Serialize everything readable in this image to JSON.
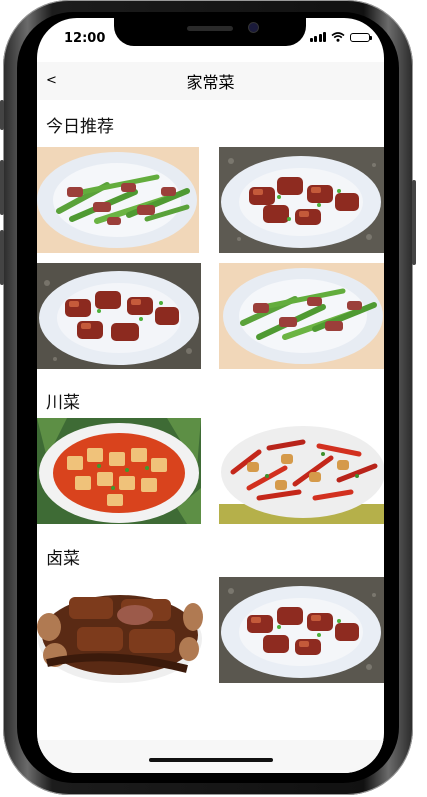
{
  "status_bar": {
    "time": "12:00"
  },
  "navbar": {
    "back_label": "<",
    "title": "家常菜"
  },
  "sections": [
    {
      "title": "今日推荐",
      "dishes": [
        "green-pepper-pork",
        "braised-pork",
        "braised-pork",
        "green-pepper-pork"
      ]
    },
    {
      "title": "川菜",
      "dishes": [
        "mapo-tofu",
        "spicy-chicken"
      ]
    },
    {
      "title": "卤菜",
      "dishes": [
        "braised-meats",
        "braised-pork"
      ]
    }
  ],
  "colors": {
    "navbar_bg": "#f7f7f7",
    "text": "#111111"
  }
}
